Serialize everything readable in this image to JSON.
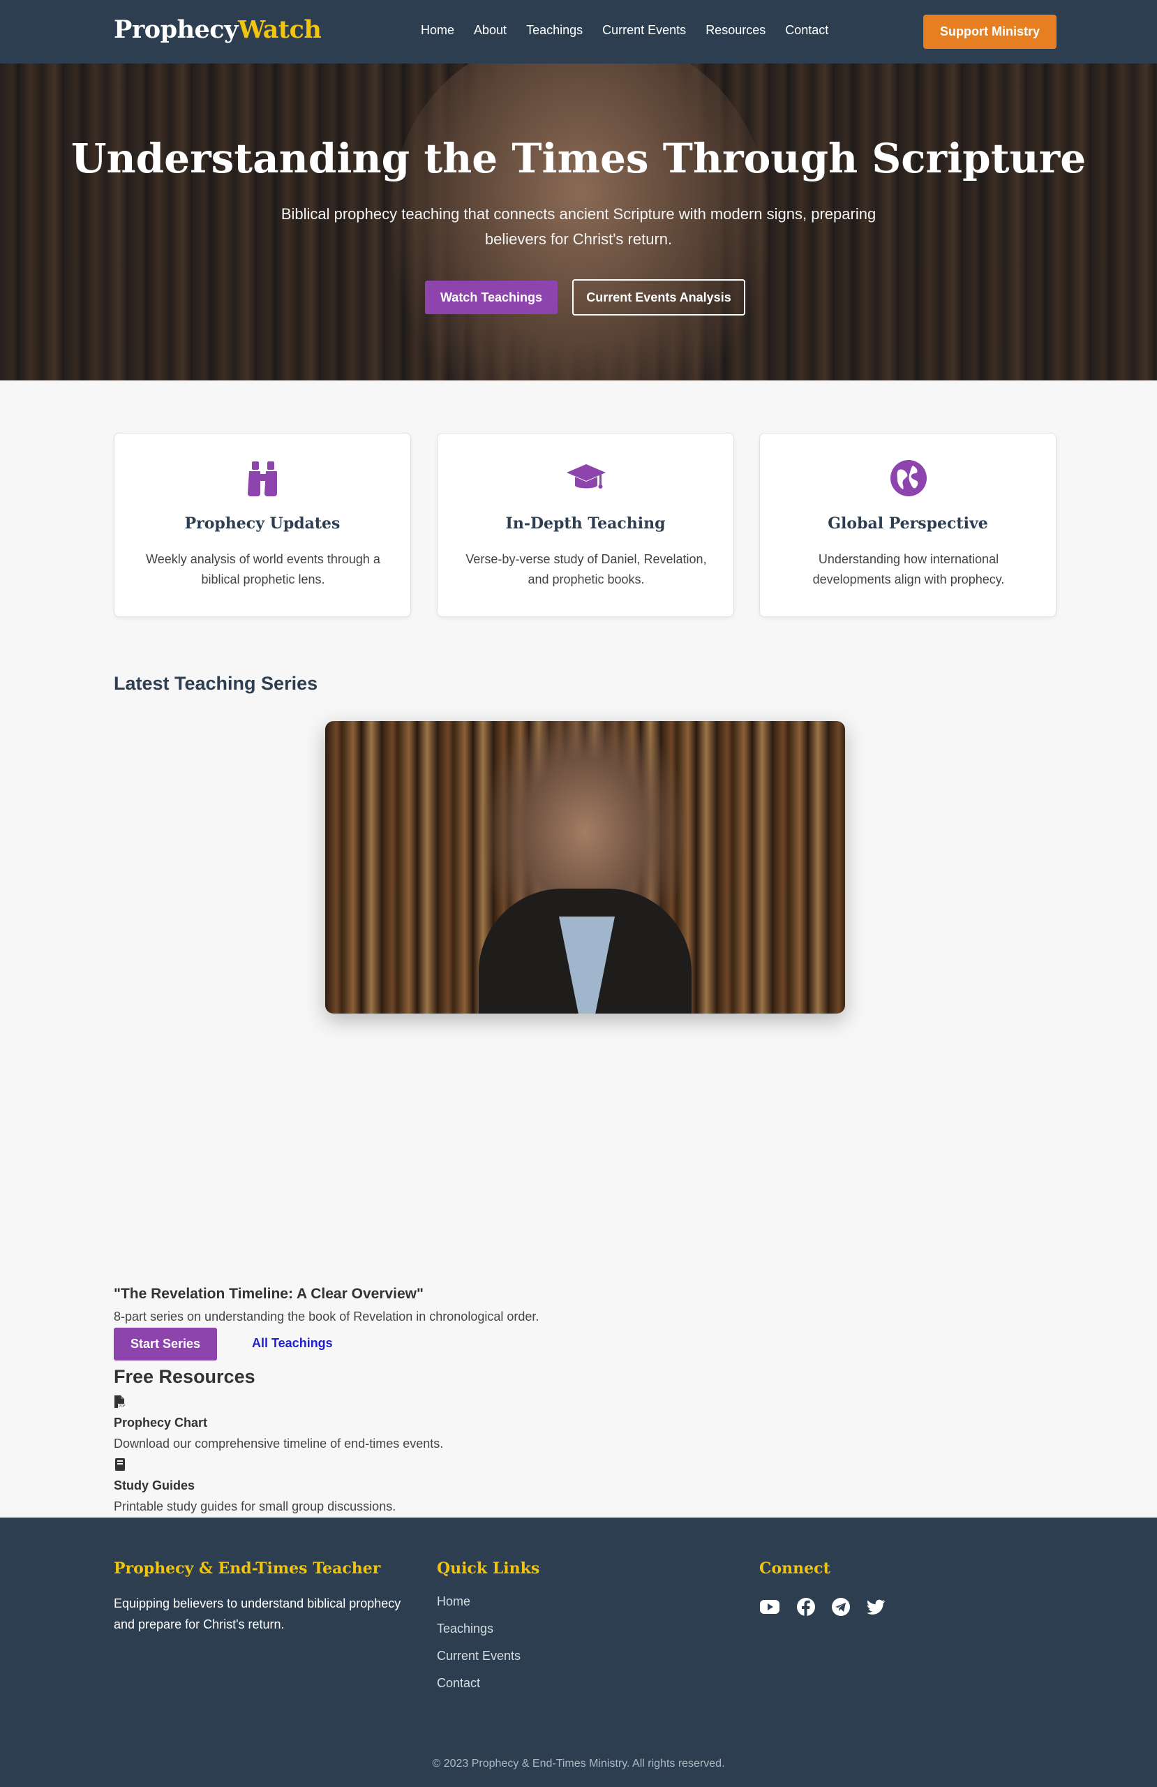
{
  "header": {
    "logo_part1": "Prophecy",
    "logo_part2": "Watch",
    "nav": [
      "Home",
      "About",
      "Teachings",
      "Current Events",
      "Resources",
      "Contact"
    ],
    "support_label": "Support Ministry"
  },
  "hero": {
    "title": "Understanding the Times Through Scripture",
    "subtitle": "Biblical prophecy teaching that connects ancient Scripture with modern signs, preparing believers for Christ's return.",
    "primary_button": "Watch Teachings",
    "secondary_button": "Current Events Analysis"
  },
  "features": [
    {
      "icon": "binoculars-icon",
      "title": "Prophecy Updates",
      "text": "Weekly analysis of world events through a biblical prophetic lens."
    },
    {
      "icon": "graduation-cap-icon",
      "title": "In-Depth Teaching",
      "text": "Verse-by-verse study of Daniel, Revelation, and prophetic books."
    },
    {
      "icon": "globe-icon",
      "title": "Global Perspective",
      "text": "Understanding how international developments align with prophecy."
    }
  ],
  "series": {
    "section_title": "Latest Teaching Series",
    "title": "\"The Revelation Timeline: A Clear Overview\"",
    "description": "8-part series on understanding the book of Revelation in chronological order.",
    "start_button": "Start Series",
    "all_link": "All Teachings"
  },
  "resources": {
    "section_title": "Free Resources",
    "items": [
      {
        "icon": "pdf-file-icon",
        "title": "Prophecy Chart",
        "text": "Download our comprehensive timeline of end-times events."
      },
      {
        "icon": "book-icon",
        "title": "Study Guides",
        "text": "Printable study guides for small group discussions."
      }
    ]
  },
  "footer": {
    "about_heading": "Prophecy & End-Times Teacher",
    "about_text": "Equipping believers to understand biblical prophecy and prepare for Christ's return.",
    "links_heading": "Quick Links",
    "links": [
      "Home",
      "Teachings",
      "Current Events",
      "Contact"
    ],
    "connect_heading": "Connect",
    "social": [
      "youtube-icon",
      "facebook-icon",
      "telegram-icon",
      "twitter-icon"
    ],
    "copyright": "© 2023 Prophecy & End-Times Ministry. All rights reserved."
  },
  "colors": {
    "navy": "#2c3e50",
    "gold": "#f1c40f",
    "orange": "#e67e22",
    "purple": "#8e44ad"
  }
}
